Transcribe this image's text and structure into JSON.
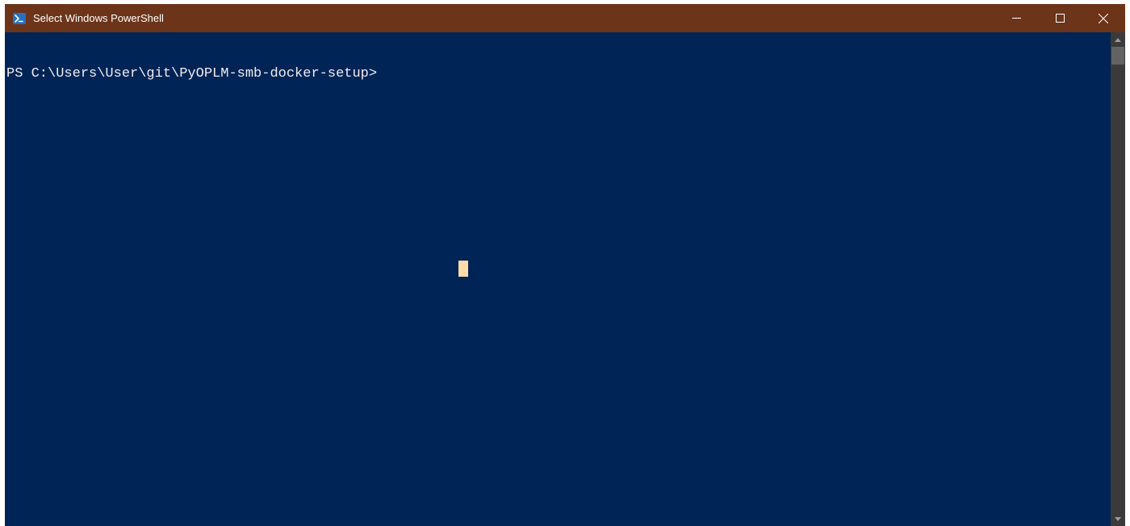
{
  "window": {
    "title": "Select Windows PowerShell"
  },
  "terminal": {
    "prompt": "PS C:\\Users\\User\\git\\PyOPLM-smb-docker-setup>"
  },
  "colors": {
    "titlebar_bg": "#6c3419",
    "terminal_bg": "#012456",
    "terminal_fg": "#eeedf0",
    "cursor": "#fedba9"
  }
}
